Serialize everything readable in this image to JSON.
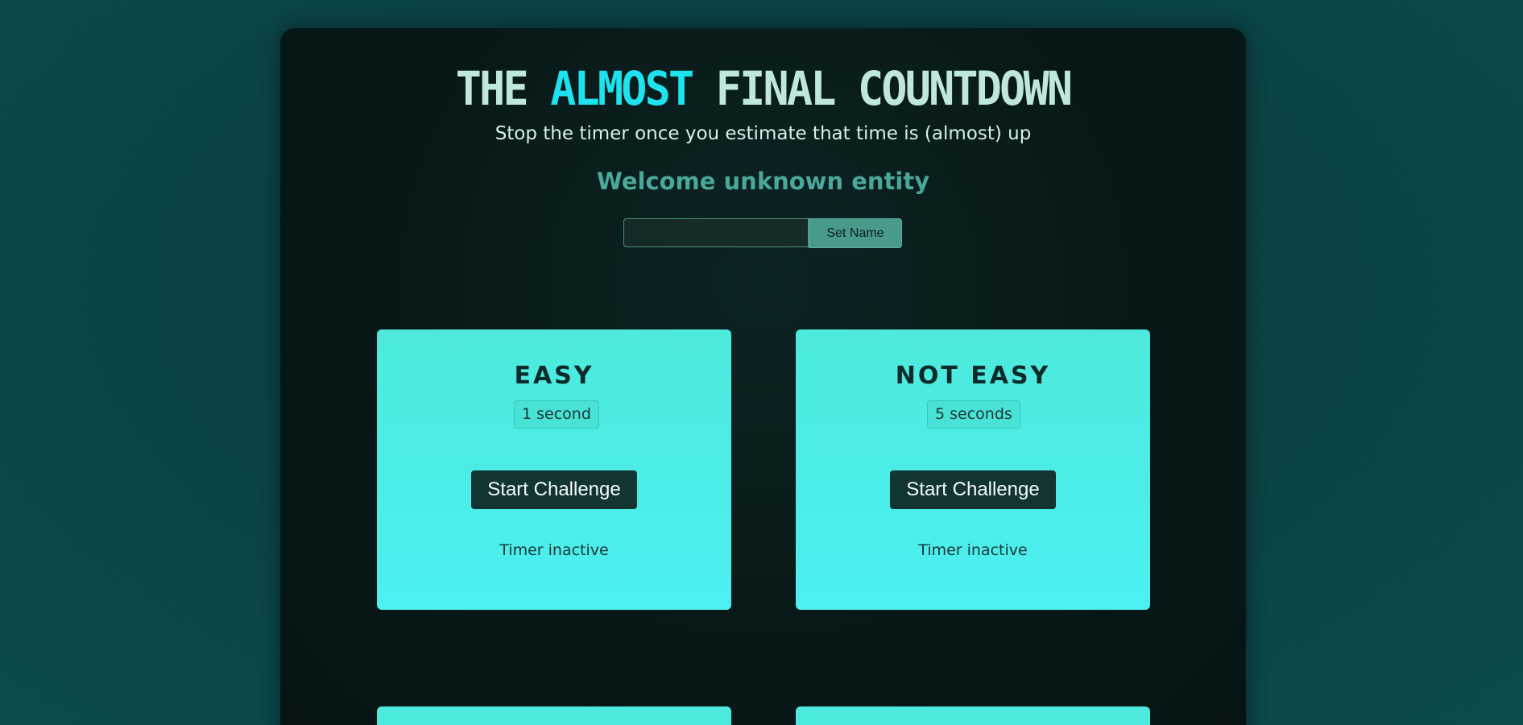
{
  "header": {
    "title_part1": "THE ",
    "title_accent": "ALMOST",
    "title_part2": " FINAL COUNTDOWN",
    "subtitle": "Stop the timer once you estimate that time is (almost) up",
    "welcome": "Welcome unknown entity"
  },
  "name_form": {
    "input_value": "",
    "input_placeholder": "",
    "button_label": "Set Name"
  },
  "challenges": [
    {
      "title": "EASY",
      "duration": "1 second",
      "button_label": "Start Challenge",
      "status": "Timer inactive"
    },
    {
      "title": "NOT EASY",
      "duration": "5 seconds",
      "button_label": "Start Challenge",
      "status": "Timer inactive"
    }
  ],
  "colors": {
    "page_background": "#0b4446",
    "panel_background": "#081818",
    "title_text": "#bfe6df",
    "title_accent": "#1ee3ee",
    "welcome_text": "#4aa89a",
    "card_background": "#4de9dc",
    "button_dark": "#123432"
  }
}
